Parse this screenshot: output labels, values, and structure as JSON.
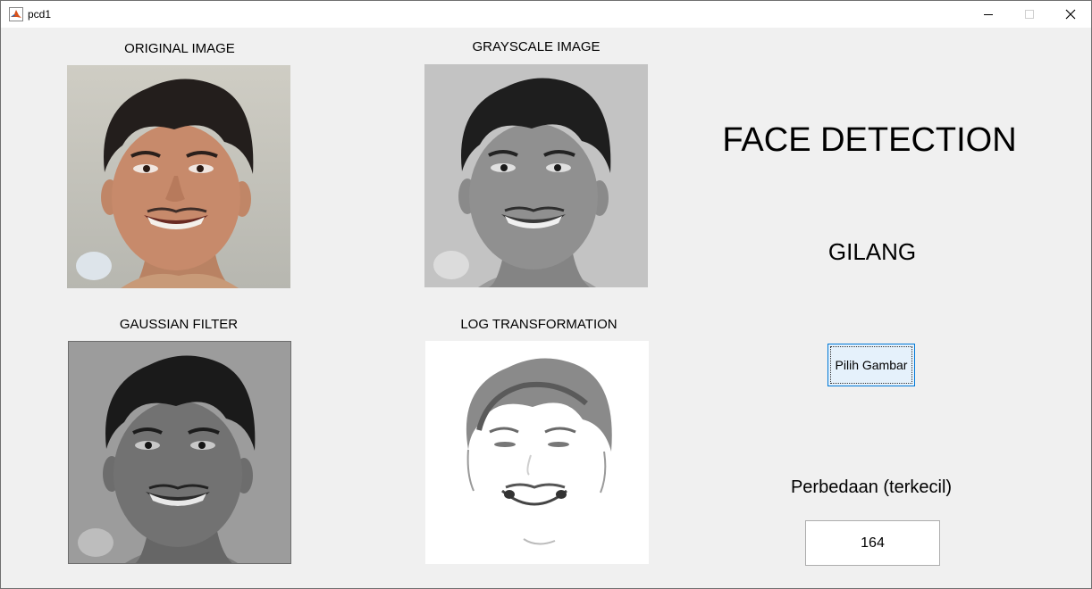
{
  "window": {
    "title": "pcd1",
    "app_icon": "matlab-icon",
    "controls": [
      "minimize-icon",
      "maximize-icon",
      "close-icon"
    ]
  },
  "panels": {
    "original": {
      "caption": "ORIGINAL IMAGE",
      "style": "color"
    },
    "grayscale": {
      "caption": "GRAYSCALE IMAGE",
      "style": "grayscale"
    },
    "gaussian": {
      "caption": "GAUSSIAN FILTER",
      "style": "blurred grayscale"
    },
    "log": {
      "caption": "LOG TRANSFORMATION",
      "style": "high-key log transform"
    }
  },
  "sidebar": {
    "title": "FACE DETECTION",
    "name": "GILANG",
    "pick_button_label": "Pilih Gambar",
    "difference_label": "Perbedaan (terkecil)",
    "difference_value": "164"
  },
  "colors": {
    "window_bg": "#f0f0f0",
    "button_bg": "#e5f1fb",
    "button_border": "#0078d7"
  }
}
